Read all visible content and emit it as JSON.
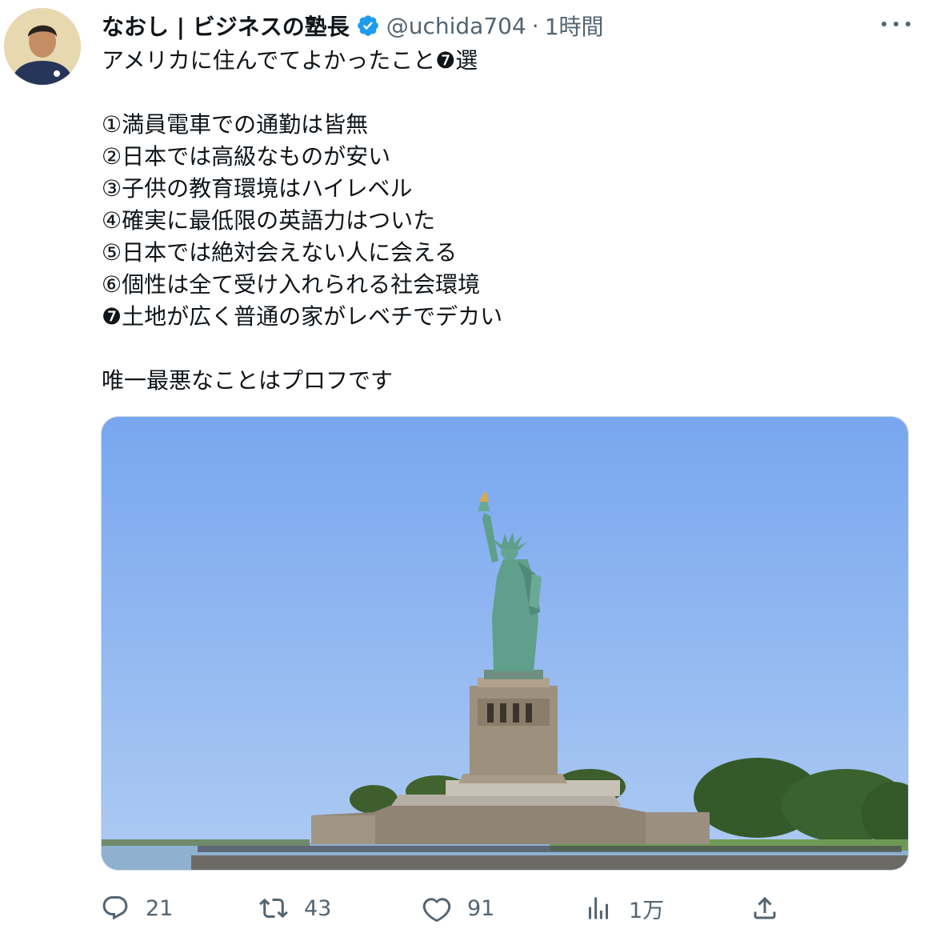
{
  "author": {
    "display_name": "なおし | ビジネスの塾長",
    "handle": "@uchida704",
    "separator": "·",
    "time": "1時間",
    "verified_icon": "verified-badge-icon",
    "avatar_icon": "avatar-photo"
  },
  "tweet": {
    "text": "アメリカに住んでてよかったこと❼選\n\n①満員電車での通勤は皆無\n②日本では高級なものが安い\n③子供の教育環境はハイレベル\n④確実に最低限の英語力はついた\n⑤日本では絶対会えない人に会える\n⑥個性は全て受け入れられる社会環境\n❼土地が広く普通の家がレベチでデカい\n\n唯一最悪なことはプロフです"
  },
  "media": {
    "description_icon": "statue-of-liberty-photo"
  },
  "actions": {
    "reply": {
      "icon": "reply-icon",
      "count": "21"
    },
    "retweet": {
      "icon": "retweet-icon",
      "count": "43"
    },
    "like": {
      "icon": "heart-icon",
      "count": "91"
    },
    "views": {
      "icon": "analytics-icon",
      "count": "1万"
    },
    "share": {
      "icon": "share-icon"
    }
  },
  "colors": {
    "text": "#0f1419",
    "secondary": "#536471",
    "verified": "#1d9bf0",
    "sky_top": "#7aa6ee",
    "sky_bottom": "#a9c9f4",
    "statue": "#5f9e8c"
  }
}
